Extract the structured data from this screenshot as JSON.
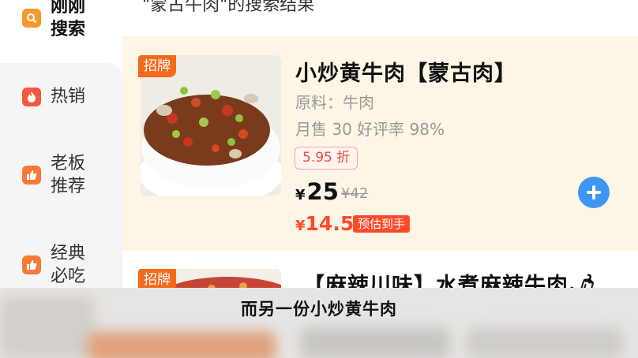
{
  "search": {
    "title": "\"蒙古牛肉\"的搜索结果"
  },
  "sidebar": {
    "items": [
      {
        "label": "刚刚\n搜索",
        "icon": "search-icon",
        "color": "#f39a2b"
      },
      {
        "label": "热销",
        "icon": "flame-icon",
        "color": "#f25a3c"
      },
      {
        "label": "老板\n推荐",
        "icon": "thumbs-up-icon",
        "color": "#f47a3a"
      },
      {
        "label": "经典\n必吃",
        "icon": "thumbs-up-icon",
        "color": "#f47a3a"
      }
    ]
  },
  "results": [
    {
      "tag": "招牌",
      "name": "小炒黄牛肉【蒙古肉】",
      "ingredient": "原料：牛肉",
      "sales": "月售 30  好评率 98%",
      "discount": "5.95 折",
      "currency": "¥",
      "price": "25",
      "original_price": "¥42",
      "estimated_price": "14.5",
      "estimated_label": "预估到手",
      "add_icon": "plus-icon"
    },
    {
      "tag": "招牌",
      "name": "【麻辣川味】水煮麻辣牛肉🌶"
    }
  ],
  "subtitle": "而另一份小炒黄牛肉",
  "colors": {
    "accent": "#f36a1c",
    "price_red": "#ff4a2a",
    "add_blue": "#3d97f0",
    "card_bg": "#fdf6e6"
  }
}
